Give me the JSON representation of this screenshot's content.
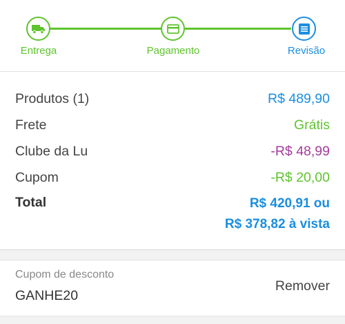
{
  "stepper": {
    "steps": [
      {
        "label": "Entrega",
        "icon": "truck-icon",
        "state": "done"
      },
      {
        "label": "Pagamento",
        "icon": "credit-card-icon",
        "state": "done"
      },
      {
        "label": "Revisão",
        "icon": "list-icon",
        "state": "current"
      }
    ],
    "colors": {
      "done": "#5ec42e",
      "current": "#1a8ee1"
    }
  },
  "summary": {
    "products": {
      "label": "Produtos (1)",
      "value": "R$ 489,90",
      "color": "#1a8ee1"
    },
    "shipping": {
      "label": "Frete",
      "value": "Grátis",
      "color": "#5ec42e"
    },
    "club": {
      "label": "Clube da Lu",
      "value": "-R$ 48,99",
      "color": "#a43c9c"
    },
    "coupon": {
      "label": "Cupom",
      "value": "-R$ 20,00",
      "color": "#5ec42e"
    },
    "total": {
      "label": "Total",
      "value_line1": "R$ 420,91 ou",
      "value_line2": "R$ 378,82 à vista",
      "color": "#1a8ee1"
    }
  },
  "coupon_box": {
    "title": "Cupom de desconto",
    "code": "GANHE20",
    "remove_label": "Remover"
  }
}
